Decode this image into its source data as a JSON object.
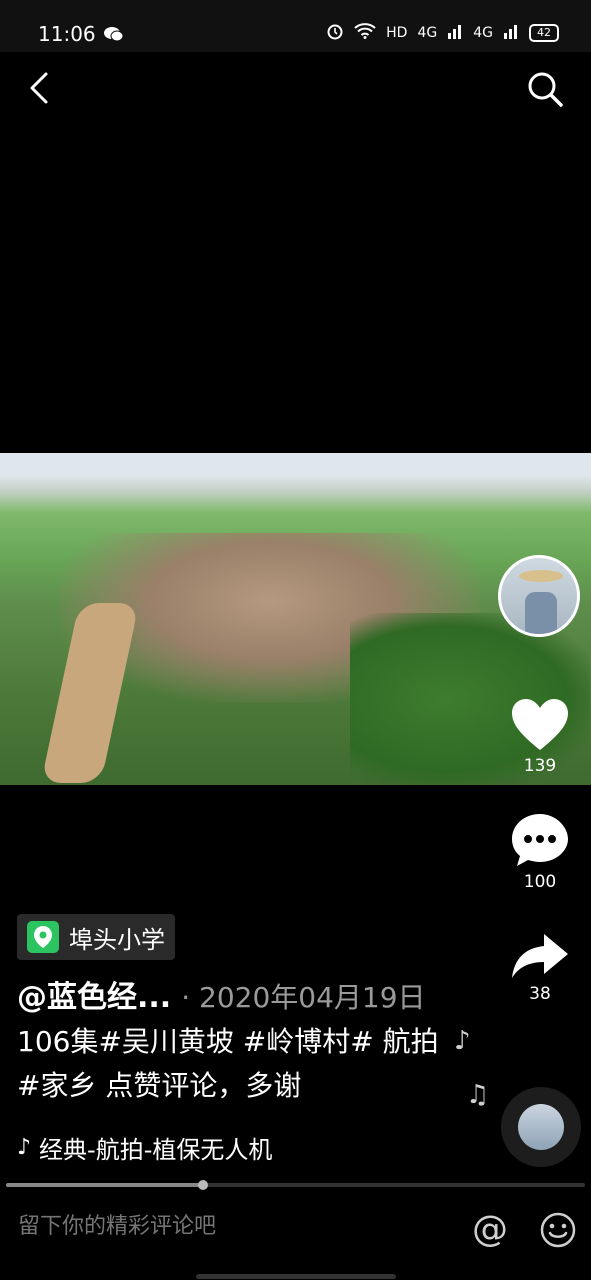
{
  "status_bar": {
    "time": "11:06",
    "network_label": "HD",
    "signal1": "4G",
    "signal2": "4G",
    "battery": "42"
  },
  "video": {
    "author": "@蓝色经...",
    "date": "· 2020年04月19日",
    "caption": "106集#吴川黄坡 #岭博村# 航拍 #家乡 点赞评论，多谢",
    "location": "埠头小学",
    "music": "经典-航拍-植保无人机",
    "progress": 0.34
  },
  "actions": {
    "likes": "139",
    "comments": "100",
    "shares": "38"
  },
  "comment_bar": {
    "placeholder": "留下你的精彩评论吧",
    "at_label": "@"
  },
  "colors": {
    "location_pin": "#2cc461",
    "background": "#000000"
  }
}
